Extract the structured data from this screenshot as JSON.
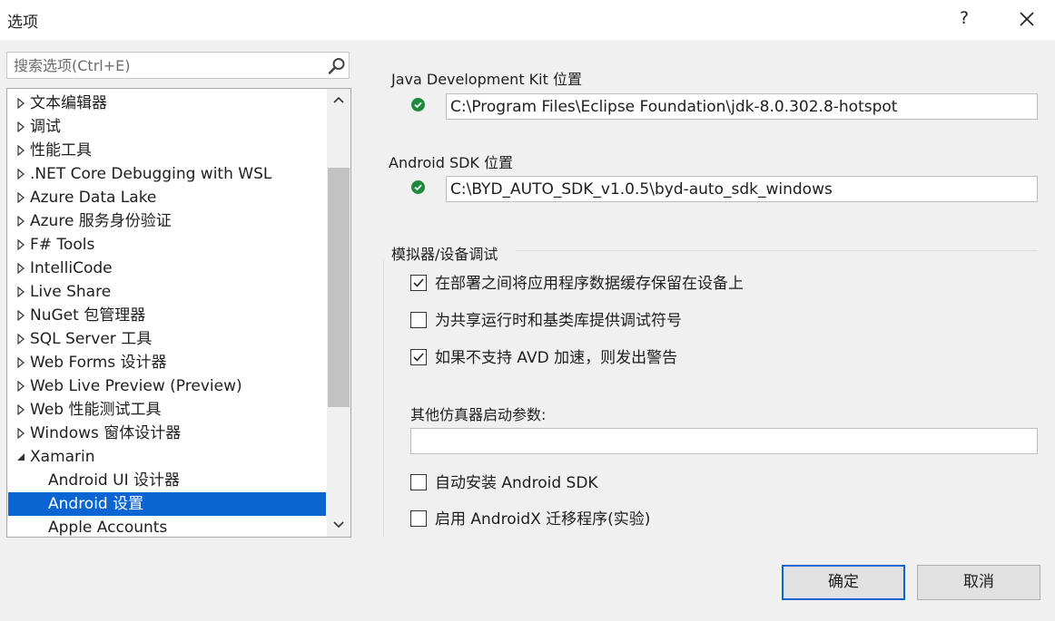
{
  "window": {
    "title": "选项",
    "help_label": "?"
  },
  "search": {
    "placeholder": "搜索选项(Ctrl+E)",
    "value": ""
  },
  "tree": {
    "items": [
      {
        "label": "文本编辑器",
        "state": "collapsed"
      },
      {
        "label": "调试",
        "state": "collapsed"
      },
      {
        "label": "性能工具",
        "state": "collapsed"
      },
      {
        "label": ".NET Core Debugging with WSL",
        "state": "collapsed"
      },
      {
        "label": "Azure Data Lake",
        "state": "collapsed"
      },
      {
        "label": "Azure 服务身份验证",
        "state": "collapsed"
      },
      {
        "label": "F# Tools",
        "state": "collapsed"
      },
      {
        "label": "IntelliCode",
        "state": "collapsed"
      },
      {
        "label": "Live Share",
        "state": "collapsed"
      },
      {
        "label": "NuGet 包管理器",
        "state": "collapsed"
      },
      {
        "label": "SQL Server 工具",
        "state": "collapsed"
      },
      {
        "label": "Web Forms 设计器",
        "state": "collapsed"
      },
      {
        "label": "Web Live Preview (Preview)",
        "state": "collapsed"
      },
      {
        "label": "Web 性能测试工具",
        "state": "collapsed"
      },
      {
        "label": "Windows 窗体设计器",
        "state": "collapsed"
      },
      {
        "label": "Xamarin",
        "state": "expanded"
      },
      {
        "label": "Android UI 设计器",
        "state": "child"
      },
      {
        "label": "Android 设置",
        "state": "child-selected"
      },
      {
        "label": "Apple Accounts",
        "state": "child"
      }
    ]
  },
  "settings": {
    "jdk": {
      "label": "Java Development Kit 位置",
      "value": "C:\\Program Files\\Eclipse Foundation\\jdk-8.0.302.8-hotspot",
      "status": "ok"
    },
    "sdk": {
      "label": "Android SDK 位置",
      "value": "C:\\BYD_AUTO_SDK_v1.0.5\\byd-auto_sdk_windows",
      "status": "ok"
    },
    "emulator_group": {
      "title": "模拟器/设备调试",
      "options": [
        {
          "label": "在部署之间将应用程序数据缓存保留在设备上",
          "checked": true
        },
        {
          "label": "为共享运行时和基类库提供调试符号",
          "checked": false
        },
        {
          "label": "如果不支持 AVD 加速，则发出警告",
          "checked": true
        }
      ],
      "extra_args_label": "其他仿真器启动参数:",
      "extra_args_value": ""
    },
    "auto_install_sdk": {
      "label": "自动安装 Android SDK",
      "checked": false
    },
    "androidx_migration": {
      "label": "启用 AndroidX 迁移程序(实验)",
      "checked": false
    }
  },
  "buttons": {
    "ok": "确定",
    "cancel": "取消"
  },
  "colors": {
    "selection": "#0a64d2",
    "status_ok": "#1e8a3c",
    "primary_border": "#0a64d2"
  }
}
